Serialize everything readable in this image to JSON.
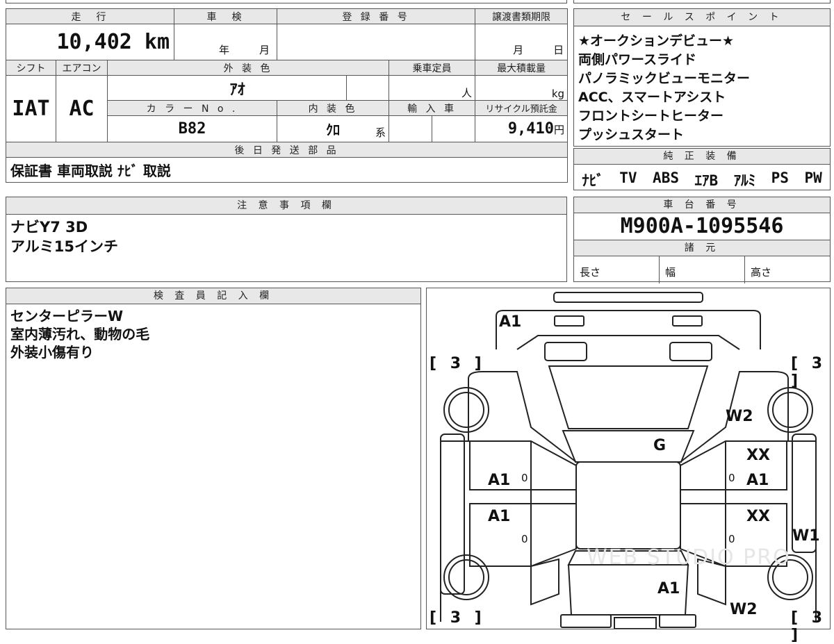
{
  "top_table": {
    "headers": {
      "mileage": "走　行",
      "inspection": "車　検",
      "registration": "登 録 番 号",
      "transfer_deadline": "譲渡書類期限",
      "shift": "シフト",
      "aircon": "エアコン",
      "exterior_color": "外 装 色",
      "capacity": "乗車定員",
      "max_load": "最大積載量",
      "color_no": "カ ラ ー N o .",
      "interior_color": "内 装 色",
      "import": "輸 入 車",
      "recycle_fee": "リサイクル預託金"
    },
    "mileage_value": "10,402 km",
    "inspection_year_unit": "年",
    "inspection_month_unit": "月",
    "transfer_month_unit": "月",
    "transfer_day_unit": "日",
    "shift_value": "IAT",
    "aircon_value": "AC",
    "exterior_color_value": "ｱｵ",
    "capacity_unit": "人",
    "max_load_unit": "kg",
    "color_no_value": "B82",
    "interior_color_value": "ｸﾛ",
    "interior_color_suffix": "系",
    "recycle_value": "9,410",
    "recycle_unit": "円"
  },
  "later_shipping": {
    "header": "後 日 発 送 部 品",
    "items": "保証書  車両取説  ﾅﾋﾞ 取説"
  },
  "sales_points": {
    "header": "セ ー ル ス ポ イ ン ト",
    "lines": [
      "★オークションデビュー★",
      "両側パワースライド",
      "パノラミックビューモニター",
      "ACC、スマートアシスト",
      "フロントシートヒーター",
      "プッシュスタート"
    ]
  },
  "genuine_equipment": {
    "header": "純 正 装 備",
    "items": [
      "ﾅﾋﾞ",
      "TV",
      "ABS",
      "ｴｱB",
      "ｱﾙﾐ",
      "PS",
      "PW"
    ]
  },
  "notes": {
    "header": "注 意 事 項 欄",
    "lines": [
      "ナビY7 3D",
      "アルミ15インチ"
    ]
  },
  "chassis": {
    "header": "車 台 番 号",
    "value": "M900A-1095546",
    "specs_header": "諸 元",
    "length_label": "長さ",
    "width_label": "幅",
    "height_label": "高さ"
  },
  "inspector": {
    "header": "検 査 員 記 入 欄",
    "lines": [
      "センターピラーW",
      "室内薄汚れ、動物の毛",
      "外装小傷有り"
    ]
  },
  "diagram": {
    "marks": {
      "roof_front": "A1",
      "front_left_bracket": "[ 3 ]",
      "front_right_bracket": "[ 3 ]",
      "rear_left_bracket": "[ 3 ]",
      "rear_right_bracket": "[ 3 ]",
      "right_front_fender": "W2",
      "windshield": "G",
      "right_front_door_1": "XX",
      "right_front_door_2": "A1",
      "right_rear_door": "XX",
      "right_pillar": "W1",
      "left_front_door": "A1",
      "left_rear_door": "A1",
      "tailgate": "A1",
      "right_rear_fender": "W2",
      "zero": "0"
    },
    "watermark": "WEB STUDIO PRO"
  }
}
